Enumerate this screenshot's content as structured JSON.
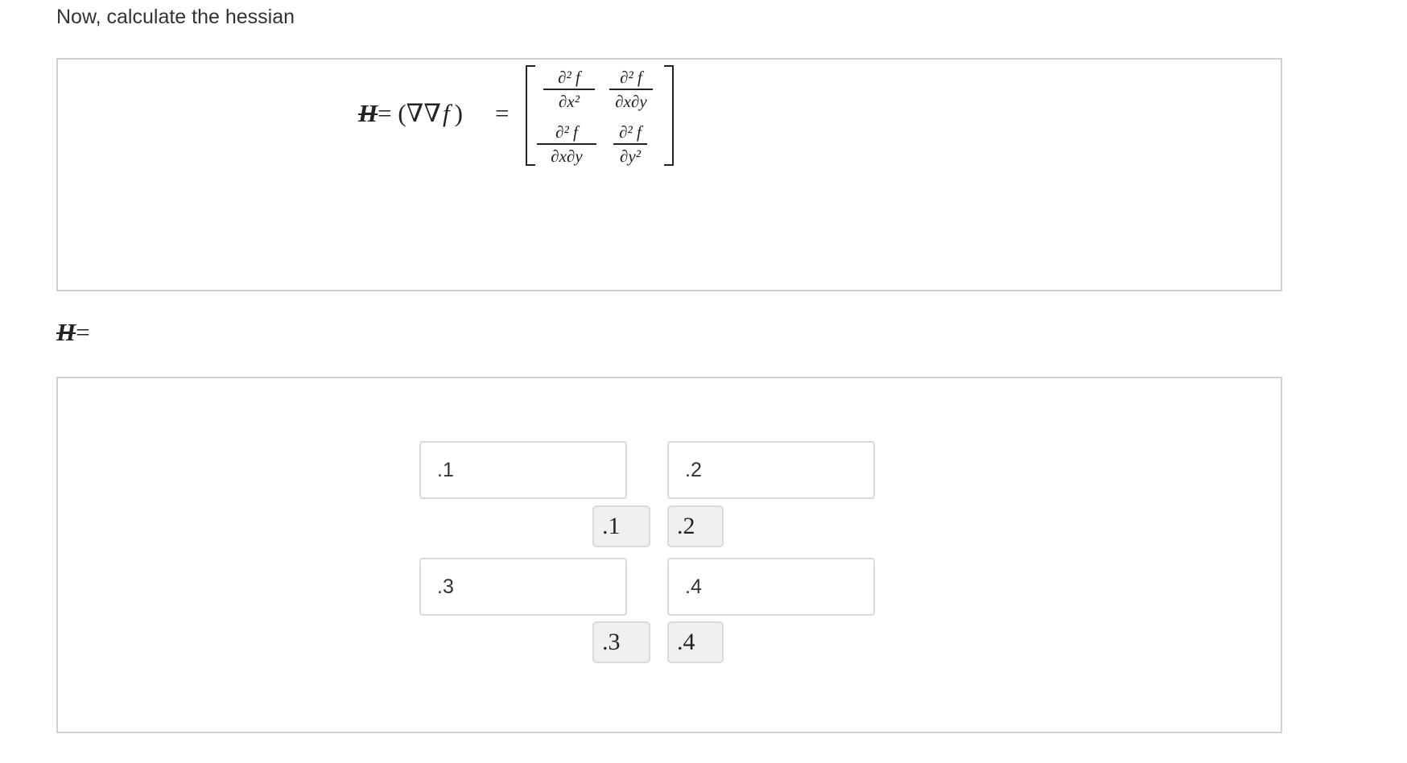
{
  "question": {
    "prompt": "Now, calculate the hessian"
  },
  "formula": {
    "lhs_symbol": "H",
    "lhs_equals": "= (∇∇",
    "lhs_function": "f",
    "lhs_close": ")",
    "equals": "=",
    "matrix": [
      [
        {
          "numerator": "∂² f",
          "denominator": "∂x²"
        },
        {
          "numerator": "∂² f",
          "denominator": "∂x∂y"
        }
      ],
      [
        {
          "numerator": "∂² f",
          "denominator": "∂x∂y"
        },
        {
          "numerator": "∂² f",
          "denominator": "∂y²"
        }
      ]
    ]
  },
  "answer": {
    "label_symbol": "H",
    "label_equals": "=",
    "inputs": [
      {
        "placeholder": ".1",
        "value": ""
      },
      {
        "placeholder": ".2",
        "value": ""
      },
      {
        "placeholder": ".3",
        "value": ""
      },
      {
        "placeholder": ".4",
        "value": ""
      }
    ],
    "chips": [
      {
        "label": ".1"
      },
      {
        "label": ".2"
      },
      {
        "label": ".3"
      },
      {
        "label": ".4"
      }
    ]
  }
}
